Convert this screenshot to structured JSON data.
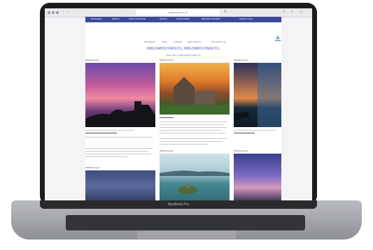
{
  "browser": {
    "url": "wildaboutargyll.co.uk"
  },
  "site": {
    "nav_items": [
      "INSTAGRAM",
      "EVENTS",
      "WALKS & WILDLIFE",
      "PHOTOS",
      "FOOD & DRINK",
      "BEACHES & ISLANDS",
      "THINGS TO DO"
    ],
    "menu_items": [
      "INSTAGRAM",
      "BLOG",
      "CONTACT",
      "ABOUT ARGYLL",
      "WILD ABOUT US"
    ],
    "hashtag": "#WILDABOUTARGYLL #WILDABOUTARGYLL",
    "subline": "Share with us #WILDABOUTARGYLL",
    "card_label": "#WildAboutArgyll"
  },
  "laptop": {
    "label": "MacBook Pro"
  },
  "colors": {
    "nav": "#3d4a9a",
    "accent": "#4a5dbf",
    "frame": "#1c1c1e"
  }
}
